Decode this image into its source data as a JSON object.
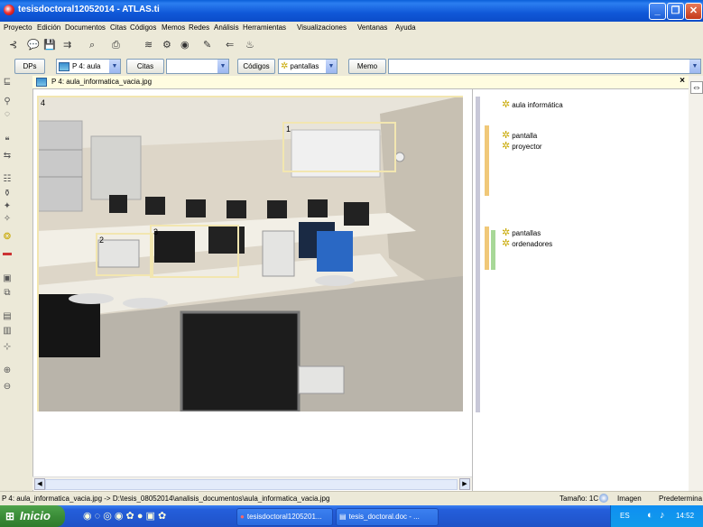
{
  "window": {
    "title": "tesisdoctoral12052014 - ATLAS.ti"
  },
  "menu": [
    "Proyecto",
    "Edición",
    "Documentos",
    "Citas",
    "Códigos",
    "Memos",
    "Redes",
    "Análisis",
    "Herramientas",
    "Visualizaciones",
    "Ventanas",
    "Ayuda"
  ],
  "toolbar2": {
    "dps_label": "DPs",
    "doc_combo": "P 4: aula",
    "citas_label": "Citas",
    "codigos_label": "Códigos",
    "codes_combo": "pantallas",
    "memo_label": "Memo"
  },
  "document": {
    "header_title": "P 4: aula_informatica_vacia.jpg"
  },
  "quotes": [
    {
      "num": "4"
    },
    {
      "num": "1"
    },
    {
      "num": "2"
    },
    {
      "num": "3"
    }
  ],
  "margin_codes": [
    "aula informática",
    "pantalla",
    "proyector",
    "pantallas",
    "ordenadores"
  ],
  "margin_bar_colors": [
    "#c8c8d8",
    "#f0c878",
    "#a8d898"
  ],
  "status": {
    "path": "P 4: aula_informatica_vacia.jpg -> D:\\tesis_08052014\\analisis_documentos\\aula_informatica_vacia.jpg",
    "tamano": "Tamaño: 1C",
    "imagen": "Imagen",
    "predeterm": "Predetermina"
  },
  "taskbar": {
    "start_label": "Inicio",
    "task1": "tesisdoctoral1205201...",
    "task2": "tesis_doctoral.doc - ...",
    "lang": "ES",
    "clock": "14:52"
  },
  "colors": {
    "titlebar": "#0b4cc9",
    "quote_border": "#f2e6b0",
    "code_icon": "#c8a800"
  }
}
